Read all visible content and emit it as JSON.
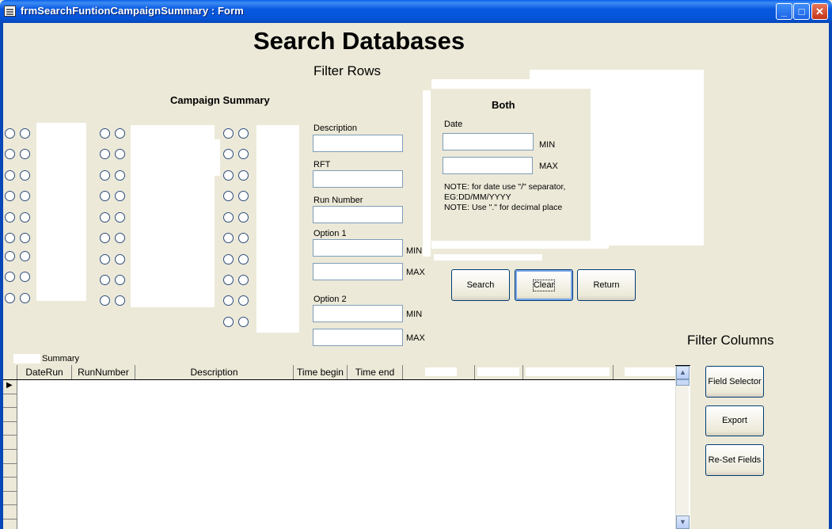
{
  "window": {
    "title": "frmSearchFuntionCampaignSummary : Form",
    "minimize": "_",
    "maximize": "□",
    "close": "✕"
  },
  "header": {
    "title": "Search Databases",
    "filter_rows": "Filter Rows",
    "filter_columns": "Filter Columns"
  },
  "campaign": {
    "label": "Campaign Summary"
  },
  "filters": {
    "description": "Description",
    "rft": "RFT",
    "run_number": "Run Number",
    "option1": "Option 1",
    "option2": "Option 2",
    "min": "MIN",
    "max": "MAX"
  },
  "both": {
    "title": "Both",
    "date": "Date",
    "min": "MIN",
    "max": "MAX",
    "note1": "NOTE: for date use \"/\" separator,",
    "note2": "EG:DD/MM/YYYY",
    "note3": "NOTE: Use \".\" for decimal place"
  },
  "buttons": {
    "search": "Search",
    "clear": "Clear",
    "return": "Return",
    "field_selector": "Field Selector",
    "export": "Export",
    "reset_fields": "Re-Set Fields"
  },
  "summary": {
    "label": "Summary"
  },
  "grid": {
    "columns": [
      "DateRun",
      "RunNumber",
      "Description",
      "Time begin",
      "Time end",
      "",
      "",
      "",
      ""
    ],
    "scroll_up": "▲",
    "scroll_down": "▼",
    "current_row_marker": "▶"
  },
  "colors": {
    "title_bar": "#0554d8",
    "background": "#ece9d8",
    "radio_border": "#2c4c7c"
  }
}
